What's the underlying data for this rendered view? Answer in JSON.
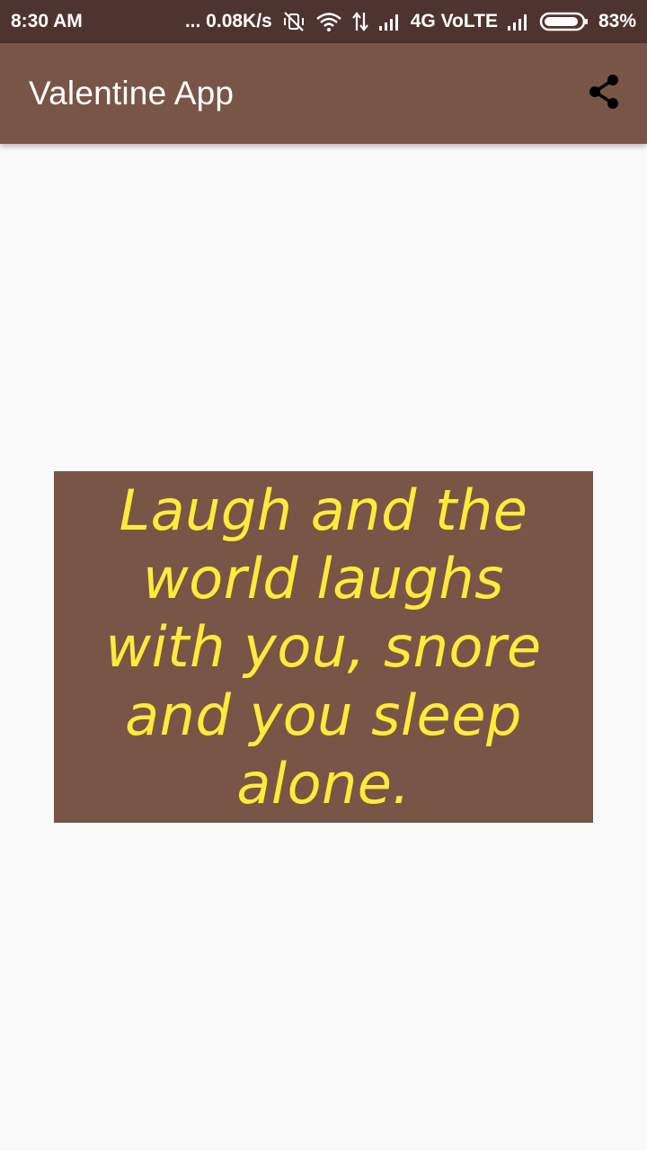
{
  "status_bar": {
    "time": "8:30 AM",
    "network_speed": "... 0.08K/s",
    "network_type": "4G VoLTE",
    "battery": "83%",
    "icons": [
      "vibrate-off-icon",
      "wifi-icon",
      "data-arrows-icon",
      "signal-icon",
      "signal-icon",
      "battery-icon"
    ]
  },
  "app_bar": {
    "title": "Valentine App",
    "share_icon": "share-icon"
  },
  "quote": {
    "text": "Laugh and the world laughs with you, snore and you sleep alone."
  },
  "colors": {
    "status_bar": "#4e342e",
    "app_bar": "#795548",
    "card": "#795548",
    "quote_text": "#ffeb3b",
    "background": "#fafafa"
  }
}
